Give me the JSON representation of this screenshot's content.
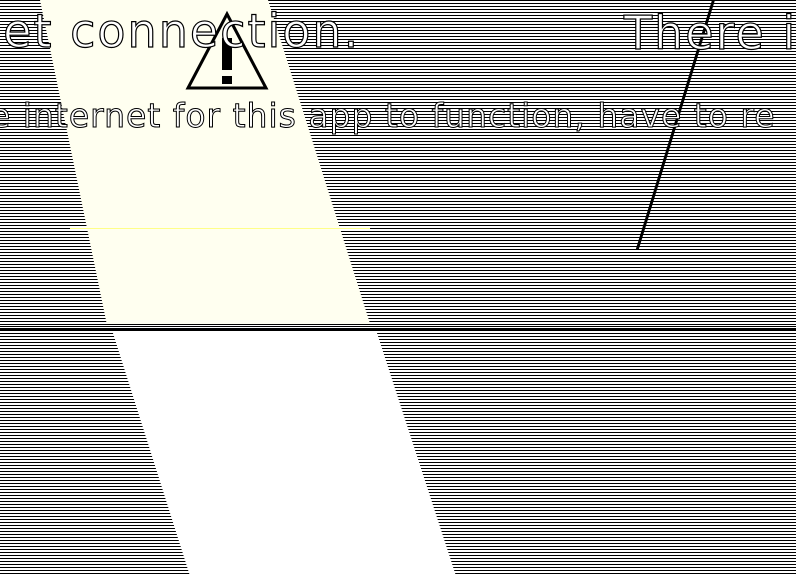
{
  "dialog": {
    "title_left": "net connection.",
    "title_right": "There i",
    "message": "e internet for this app to function, have to re"
  },
  "icons": {
    "alert": "warning-icon"
  },
  "colors": {
    "background_stripe": "#000000",
    "cream": "#fffff0",
    "accent_line": "#ffff88"
  }
}
